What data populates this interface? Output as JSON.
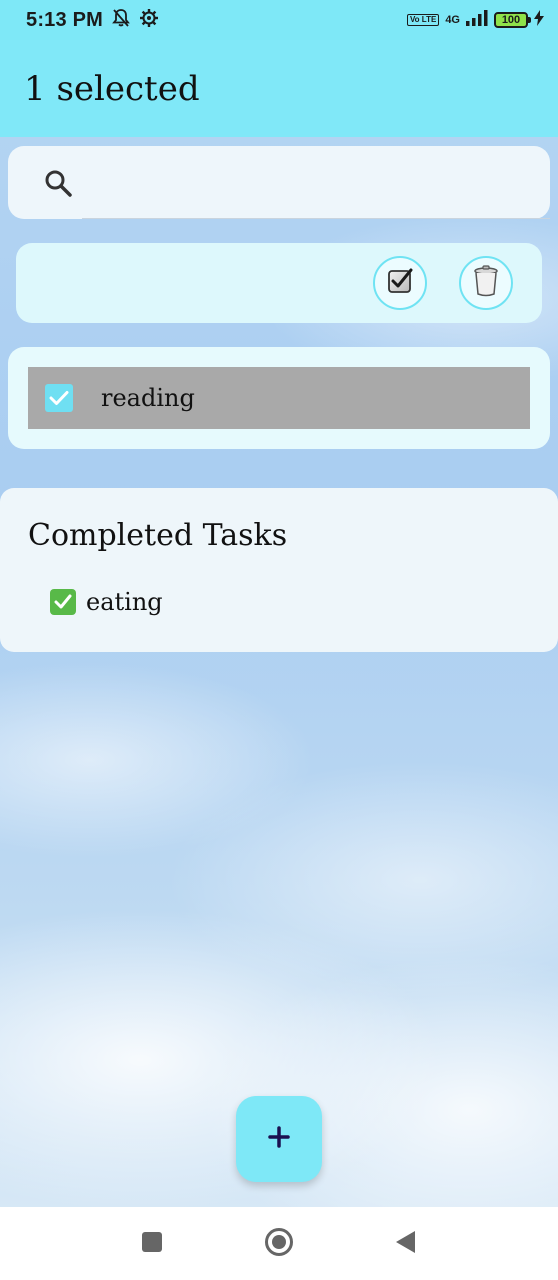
{
  "status_bar": {
    "time": "5:13 PM",
    "volte": "Vo LTE",
    "network": "4G",
    "battery": "100",
    "icons": [
      "notification-off-icon",
      "settings-icon",
      "volte-icon",
      "signal-icon",
      "battery-icon",
      "charging-icon"
    ]
  },
  "app_bar": {
    "title": "1 selected"
  },
  "search": {
    "value": "",
    "placeholder": "",
    "icon": "search-icon"
  },
  "actions": {
    "mark_complete_icon": "checkbox-icon",
    "delete_icon": "trash-icon"
  },
  "tasks": [
    {
      "label": "reading",
      "checked": true
    }
  ],
  "completed": {
    "title": "Completed Tasks",
    "items": [
      {
        "label": "eating",
        "icon": "check-mark-icon"
      }
    ]
  },
  "fab": {
    "icon": "plus-icon"
  },
  "nav": {
    "icons": [
      "recent-apps-icon",
      "home-icon",
      "back-icon"
    ]
  },
  "colors": {
    "accent": "#7ee8f7",
    "selected_row": "#a9a9a9",
    "done_green": "#58b948"
  }
}
